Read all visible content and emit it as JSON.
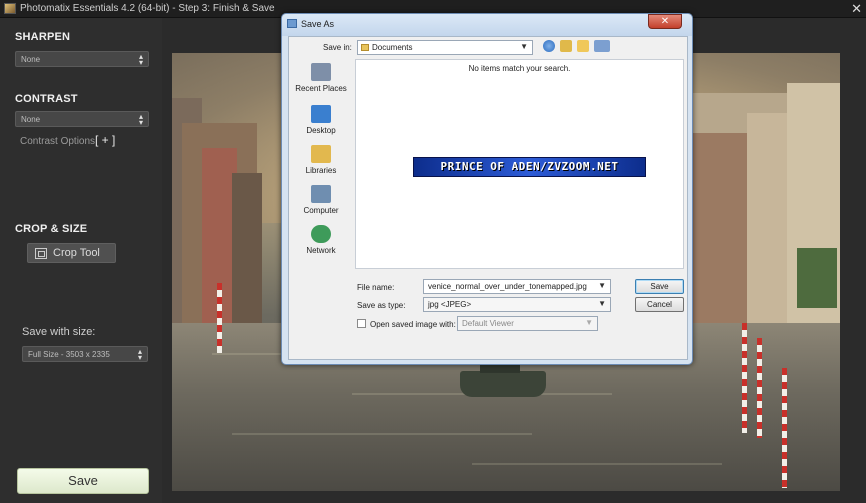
{
  "app": {
    "title": "Photomatix Essentials 4.2 (64-bit) - Step 3: Finish & Save",
    "close_glyph": "✕"
  },
  "sidebar": {
    "sharpen": {
      "title": "SHARPEN",
      "value": "None"
    },
    "contrast": {
      "title": "CONTRAST",
      "value": "None",
      "options_label": "Contrast Options",
      "options_toggle": "[ + ]"
    },
    "crop": {
      "title": "CROP & SIZE",
      "button_label": "Crop Tool"
    },
    "save_size": {
      "label": "Save with size:",
      "value": "Full Size - 3503 x 2335"
    },
    "save_button": "Save"
  },
  "dialog": {
    "title": "Save As",
    "close_glyph": "✕",
    "save_in_label": "Save in:",
    "save_in_value": "Documents",
    "empty_message": "No items match your search.",
    "watermark_text": "PRINCE OF ADEN/ZVZOOM.NET",
    "places": [
      {
        "label": "Recent Places",
        "icon": "recent-places-icon",
        "color": "#7e8fa8"
      },
      {
        "label": "Desktop",
        "icon": "desktop-icon",
        "color": "#3a7fcf"
      },
      {
        "label": "Libraries",
        "icon": "libraries-icon",
        "color": "#e2b84e"
      },
      {
        "label": "Computer",
        "icon": "computer-icon",
        "color": "#6f8eb0"
      },
      {
        "label": "Network",
        "icon": "network-icon",
        "color": "#3e9b5a"
      }
    ],
    "file_name_label": "File name:",
    "file_name_value": "venice_normal_over_under_tonemapped.jpg",
    "save_type_label": "Save as type:",
    "save_type_value": "jpg <JPEG>",
    "open_saved_label": "Open saved image with:",
    "viewer_value": "Default Viewer",
    "save_button": "Save",
    "cancel_button": "Cancel",
    "toolbar_icons": [
      "back-globe-icon",
      "up-folder-icon",
      "new-folder-icon",
      "view-menu-icon"
    ]
  },
  "colors": {
    "accent_save": "#e8f2da",
    "dialog_frame": "#c3d6ec",
    "close_red": "#c3402c"
  }
}
